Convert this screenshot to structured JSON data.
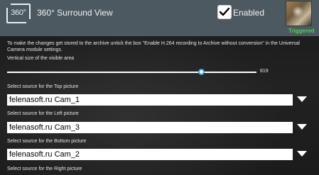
{
  "header": {
    "logo_text": "360°",
    "title": "360° Surround View",
    "enabled_label": "Enabled",
    "enabled_checked": true,
    "status_text": "Triggered",
    "status_color": "#4cd14c",
    "header_color": "#4d5960"
  },
  "info_text": "To make the changes get stored to the archive untick the box \"Enable H.264 recording to Archive without conversion\" in the Universal Camera module settings.",
  "slider": {
    "label": "Vertical size of the visible area",
    "value": "819",
    "fraction": 0.78,
    "accent_color": "#3aa3e3"
  },
  "sources": [
    {
      "label": "Select source for the Top picture",
      "value": "felenasoft.ru Cam_1"
    },
    {
      "label": "Select source for the Left picture",
      "value": "felenasoft.ru Cam_3"
    },
    {
      "label": "Select source for the Bottom picture",
      "value": "felenasoft.ru Cam_2"
    },
    {
      "label": "Select source for the Right picture",
      "value": ""
    }
  ],
  "icons": {
    "logo": "360-view-icon",
    "checkbox": "checkmark-icon",
    "dropdown": "chevron-down-icon",
    "thumbnail": "camera-thumbnail"
  }
}
